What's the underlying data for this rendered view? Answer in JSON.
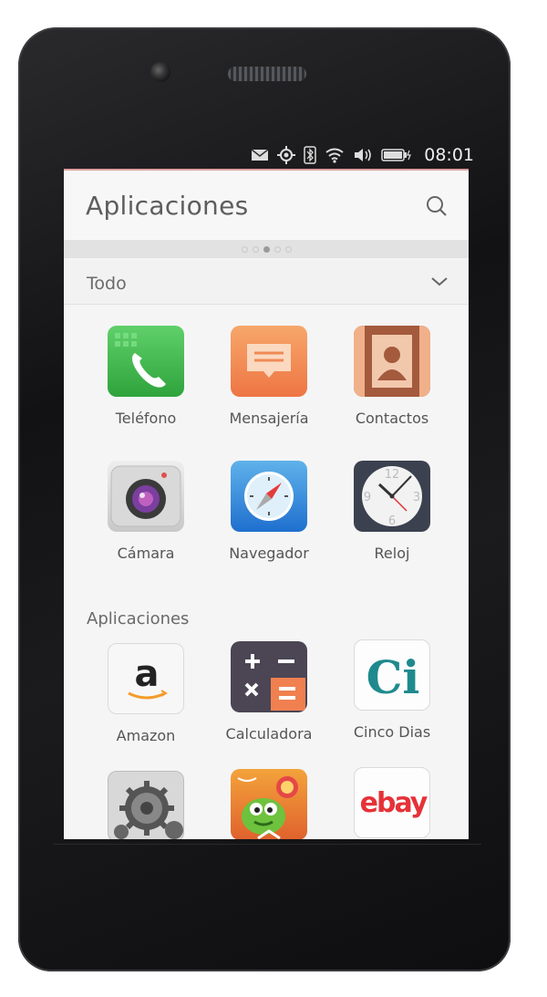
{
  "status_bar": {
    "time": "08:01",
    "icons": [
      "mail-icon",
      "location-icon",
      "bluetooth-icon",
      "wifi-icon",
      "volume-icon",
      "battery-icon"
    ]
  },
  "header": {
    "title": "Aplicaciones",
    "search_icon": "search-icon"
  },
  "pager": {
    "dot_count": 5,
    "active_index": 2
  },
  "filter": {
    "label": "Todo",
    "icon": "chevron-down-icon"
  },
  "favorites": [
    {
      "label": "Teléfono",
      "icon": "phone-icon"
    },
    {
      "label": "Mensajería",
      "icon": "messaging-icon"
    },
    {
      "label": "Contactos",
      "icon": "contacts-icon"
    },
    {
      "label": "Cámara",
      "icon": "camera-icon"
    },
    {
      "label": "Navegador",
      "icon": "browser-icon"
    },
    {
      "label": "Reloj",
      "icon": "clock-icon"
    }
  ],
  "apps_section": {
    "title": "Aplicaciones",
    "apps": [
      {
        "label": "Amazon",
        "icon": "amazon-icon"
      },
      {
        "label": "Calculadora",
        "icon": "calculator-icon"
      },
      {
        "label": "Cinco Dias",
        "icon": "cinco-dias-icon"
      },
      {
        "label": "",
        "icon": "settings-gears-icon"
      },
      {
        "label": "",
        "icon": "cut-the-rope-icon"
      },
      {
        "label": "",
        "icon": "ebay-icon"
      }
    ]
  },
  "logos": {
    "amazon": "a",
    "cinco_dias": "Ci",
    "ebay": "ebay"
  },
  "clock_face": {
    "n12": "12",
    "n3": "3",
    "n6": "6",
    "n9": "9"
  },
  "colors": {
    "phone_green": "#3fb544",
    "message_orange": "#f2884e",
    "contacts_brown": "#a0583c",
    "calc_dark": "#4b4554",
    "calc_orange": "#f08050"
  }
}
